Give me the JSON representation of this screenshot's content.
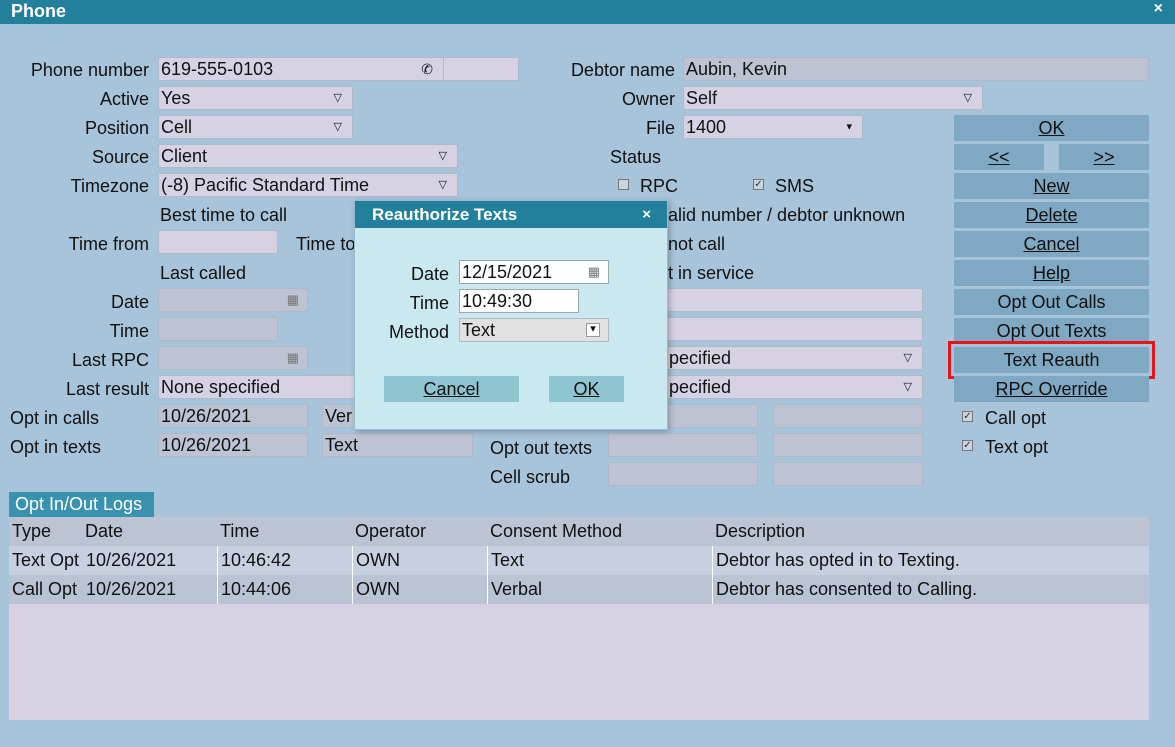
{
  "window": {
    "title": "Phone",
    "close_glyph": "×"
  },
  "form": {
    "phone_number": {
      "label": "Phone number",
      "value": "619-555-0103",
      "icon": "phone-icon"
    },
    "active": {
      "label": "Active",
      "value": "Yes"
    },
    "position": {
      "label": "Position",
      "value": "Cell"
    },
    "source": {
      "label": "Source",
      "value": "Client"
    },
    "timezone": {
      "label": "Timezone",
      "value": "(-8) Pacific Standard Time"
    },
    "best_time_label": "Best time to call",
    "time_from": {
      "label": "Time from",
      "value": ""
    },
    "time_to": {
      "label": "Time to"
    },
    "last_called_label": "Last called",
    "date": {
      "label": "Date",
      "value": ""
    },
    "time": {
      "label": "Time",
      "value": ""
    },
    "last_rpc": {
      "label": "Last RPC",
      "value": ""
    },
    "last_result": {
      "label": "Last result",
      "value": "None specified"
    },
    "opt_in_calls": {
      "label": "Opt in calls",
      "date": "10/26/2021",
      "method": "Ver"
    },
    "opt_in_texts": {
      "label": "Opt in texts",
      "date": "10/26/2021",
      "method": "Text"
    },
    "opt_out_texts_label": "Opt out texts",
    "cell_scrub_label": "Cell scrub",
    "debtor_name": {
      "label": "Debtor name",
      "value": "Aubin, Kevin"
    },
    "owner": {
      "label": "Owner",
      "value": "Self"
    },
    "file": {
      "label": "File",
      "value": "1400"
    },
    "status": {
      "label": "Status",
      "rpc_label": "RPC",
      "rpc_checked": false,
      "sms_label": "SMS",
      "sms_checked": true,
      "invalid_label": "alid number / debtor unknown",
      "donotcall_label": "not call",
      "notinservice_label": "t in service"
    },
    "right_dd1": "pecified",
    "right_dd2": "pecified",
    "call_opt": {
      "label": "Call opt",
      "checked": true
    },
    "text_opt": {
      "label": "Text opt",
      "checked": true
    }
  },
  "buttons": {
    "ok": "OK",
    "prev": "<<",
    "next": ">>",
    "new": "New",
    "delete": "Delete",
    "cancel": "Cancel",
    "help": "Help",
    "opt_out_calls": "Opt Out Calls",
    "opt_out_texts": "Opt Out Texts",
    "text_reauth": "Text Reauth",
    "rpc_override": "RPC Override"
  },
  "logs": {
    "tab_label": "Opt In/Out Logs",
    "columns": [
      "Type",
      "Date",
      "Time",
      "Operator",
      "Consent Method",
      "Description"
    ],
    "rows": [
      [
        "Text Opt",
        "10/26/2021",
        "10:46:42",
        "OWN",
        "Text",
        "Debtor has opted in to Texting."
      ],
      [
        "Call Opt",
        "10/26/2021",
        "10:44:06",
        "OWN",
        "Verbal",
        "Debtor has consented to Calling."
      ]
    ]
  },
  "modal": {
    "title": "Reauthorize Texts",
    "close_glyph": "×",
    "date_label": "Date",
    "date_value": "12/15/2021",
    "time_label": "Time",
    "time_value": "10:49:30",
    "method_label": "Method",
    "method_value": "Text",
    "cancel_label": "Cancel",
    "ok_label": "OK"
  },
  "colors": {
    "titlebar": "#22809c",
    "background": "#a8c4da",
    "button": "#7fa8c3",
    "highlight": "#e8141c",
    "field": "#d6d2e4"
  }
}
